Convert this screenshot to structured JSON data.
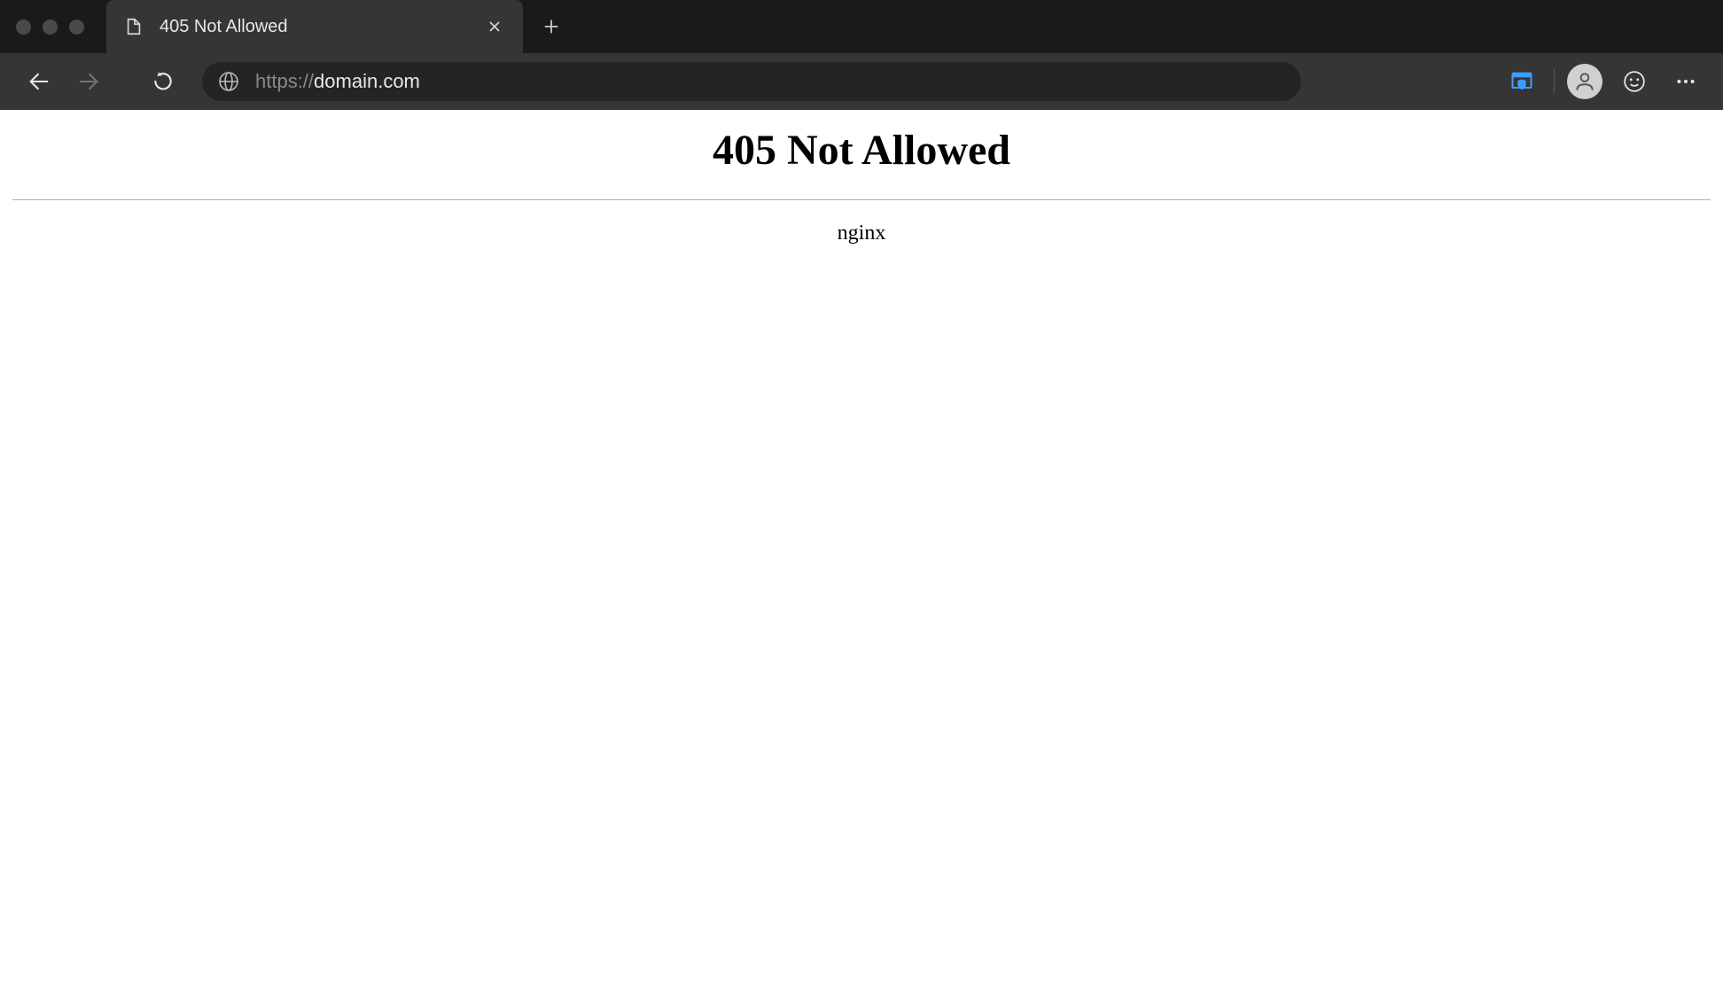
{
  "tab": {
    "title": "405 Not Allowed"
  },
  "address": {
    "protocol": "https://",
    "domain": "domain.com"
  },
  "page": {
    "heading": "405 Not Allowed",
    "server": "nginx"
  }
}
